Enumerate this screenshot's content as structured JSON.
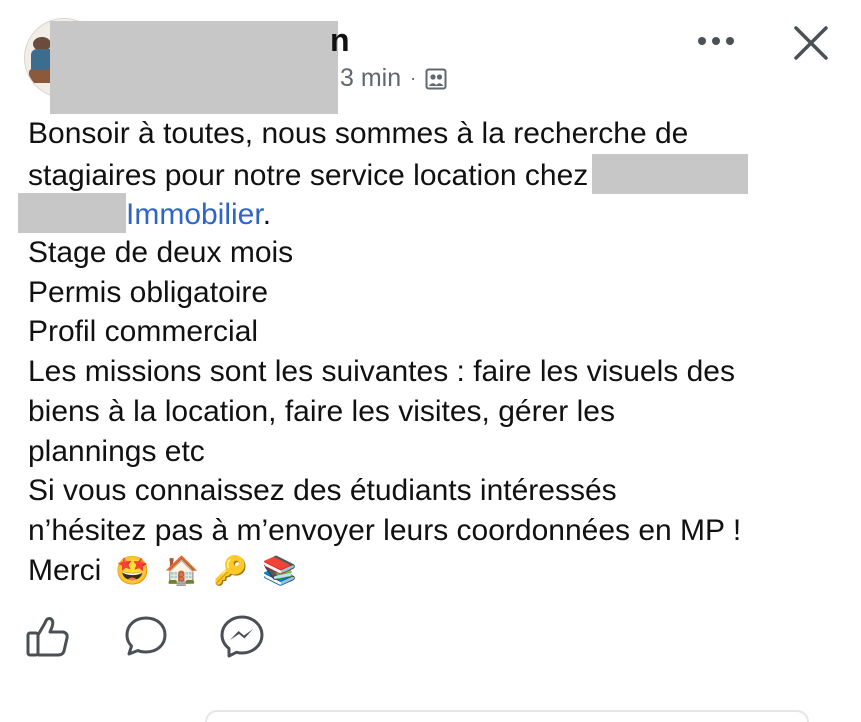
{
  "header": {
    "name_visible_fragment": "n",
    "time": "3 min",
    "separator": "·",
    "audience_icon": "group-audience-icon",
    "more_icon": "more-dots-icon",
    "close_icon": "close-x-icon"
  },
  "post": {
    "line1": "Bonsoir à toutes, nous sommes à la recherche de",
    "line2": "stagiaires pour notre service location chez",
    "line3_link": "Immobilier",
    "line3_tail": ".",
    "line4": "Stage de deux mois",
    "line5": "Permis obligatoire",
    "line6": "Profil commercial",
    "line7": "Les missions sont les suivantes : faire les visuels des",
    "line8": "biens à la location, faire les visites, gérer les",
    "line9": "plannings etc",
    "line10": "Si vous connaissez des étudiants intéressés",
    "line11": "n’hésitez pas à m’envoyer leurs coordonnées en MP !",
    "line12": "Merci",
    "emojis": [
      "🤩",
      "🏠",
      "🔑",
      "📚"
    ]
  },
  "actions": {
    "icons": [
      "like-icon",
      "comment-icon",
      "messenger-share-icon"
    ]
  },
  "colors": {
    "text": "#111111",
    "meta": "#606770",
    "link": "#2d66c5",
    "redaction": "#c7c7c7",
    "icon": "#4b4f56"
  }
}
